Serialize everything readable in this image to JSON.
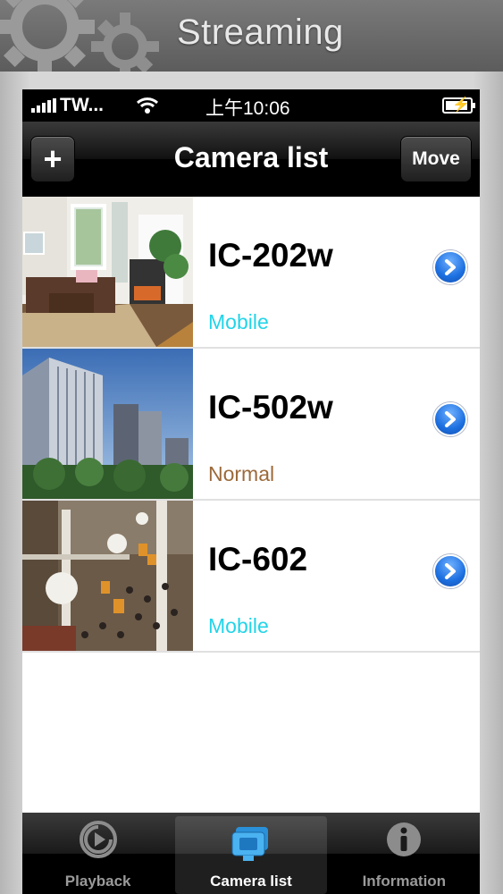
{
  "banner": {
    "title": "Streaming"
  },
  "status_bar": {
    "carrier": "TW...",
    "time": "上午10:06"
  },
  "nav_bar": {
    "title": "Camera list",
    "add_label": "+",
    "move_label": "Move"
  },
  "cameras": [
    {
      "name": "IC-202w",
      "mode": "Mobile",
      "mode_color": "#22d4e8"
    },
    {
      "name": "IC-502w",
      "mode": "Normal",
      "mode_color": "#9c6a3a"
    },
    {
      "name": "IC-602",
      "mode": "Mobile",
      "mode_color": "#22d4e8"
    }
  ],
  "tabs": [
    {
      "label": "Playback",
      "icon": "playback-icon",
      "active": false
    },
    {
      "label": "Camera list",
      "icon": "camera-list-icon",
      "active": true
    },
    {
      "label": "Information",
      "icon": "info-icon",
      "active": false
    }
  ],
  "colors": {
    "accent_blue": "#1c6fe0",
    "nav_black": "#000000"
  }
}
